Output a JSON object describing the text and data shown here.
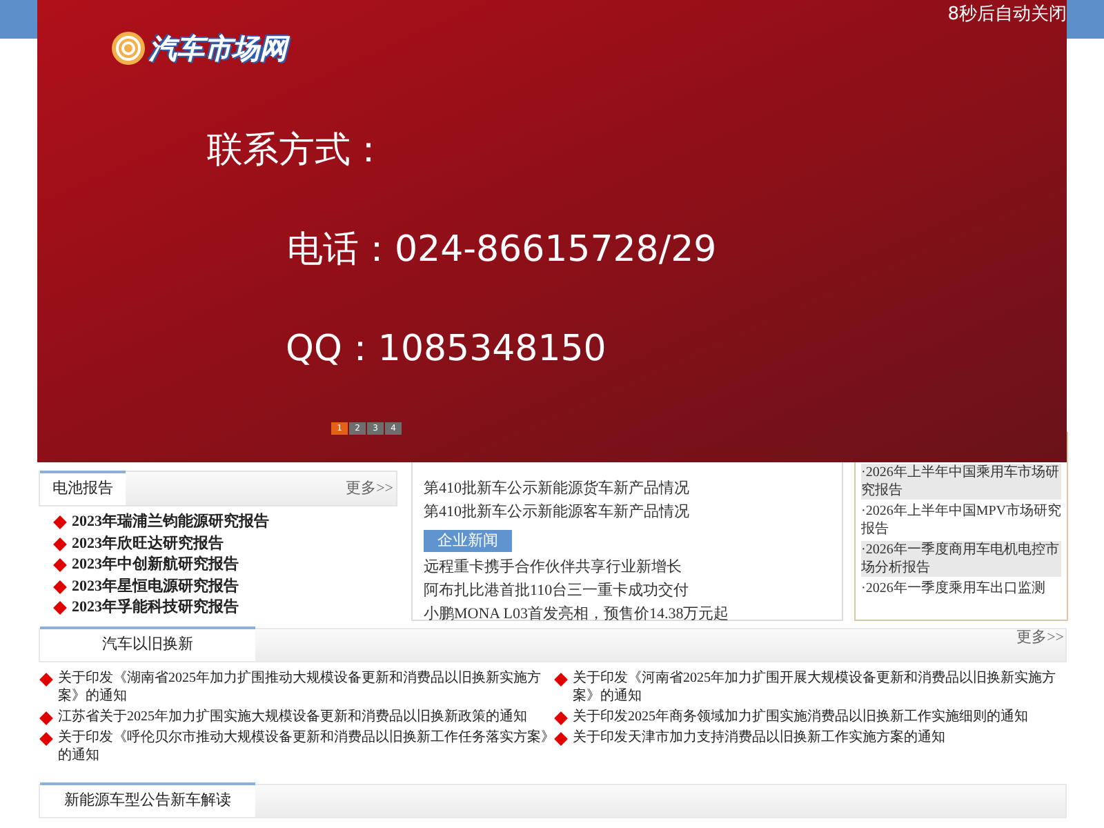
{
  "popup": {
    "logo_text": "汽车市场网",
    "countdown": "8秒后自动关闭",
    "heading": "联系方式：",
    "phone": "电话：024-86615728/29",
    "qq": "QQ：1085348150",
    "pager": [
      {
        "label": "1",
        "selected": true
      },
      {
        "label": "2",
        "selected": false
      },
      {
        "label": "3",
        "selected": false
      },
      {
        "label": "4",
        "selected": false
      }
    ]
  },
  "battery_reports": {
    "tab": "电池报告",
    "more": "更多>>",
    "items": [
      "2023年瑞浦兰钧能源研究报告",
      "2023年欣旺达研究报告",
      "2023年中创新航研究报告",
      "2023年星恒电源研究报告",
      "2023年孚能科技研究报告"
    ]
  },
  "news": {
    "items": [
      {
        "kind": "link",
        "text": "第410批新车公示新能源货车新产品情况"
      },
      {
        "kind": "link",
        "text": "第410批新车公示新能源客车新产品情况"
      },
      {
        "kind": "tag",
        "text": "企业新闻"
      },
      {
        "kind": "link",
        "text": "远程重卡携手合作伙伴共享行业新增长"
      },
      {
        "kind": "link",
        "text": "阿布扎比港首批110台三一重卡成功交付"
      },
      {
        "kind": "link",
        "text": "小鹏MONA L03首发亮相，预售价14.38万元起"
      }
    ]
  },
  "research_reports": {
    "items": [
      {
        "text": "·2026年上半年中国乘用车市场研究报告",
        "highlighted": true
      },
      {
        "text": "·2026年上半年中国MPV市场研究报告",
        "highlighted": false
      },
      {
        "text": "·2026年一季度商用车电机电控市场分析报告",
        "highlighted": true
      },
      {
        "text": "·2026年一季度乘用车出口监测",
        "highlighted": false
      }
    ]
  },
  "trade_in": {
    "tab": "汽车以旧换新",
    "more": "更多>>",
    "left_items": [
      "关于印发《湖南省2025年加力扩围推动大规模设备更新和消费品以旧换新实施方案》的通知",
      "江苏省关于2025年加力扩围实施大规模设备更新和消费品以旧换新政策的通知",
      "关于印发《呼伦贝尔市推动大规模设备更新和消费品以旧换新工作任务落实方案》的通知"
    ],
    "right_items": [
      "关于印发《河南省2025年加力扩围开展大规模设备更新和消费品以旧换新实施方案》的通知",
      "关于印发2025年商务领域加力扩围实施消费品以旧换新工作实施细则的通知",
      "关于印发天津市加力支持消费品以旧换新工作实施方案的通知"
    ]
  },
  "new_energy": {
    "tab": "新能源车型公告新车解读"
  }
}
